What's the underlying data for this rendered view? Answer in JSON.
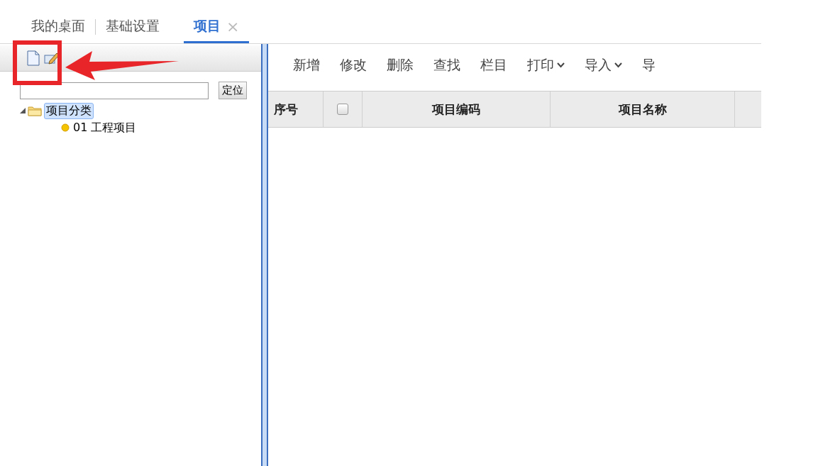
{
  "tabs": [
    {
      "label": "我的桌面",
      "selected": false,
      "closable": false
    },
    {
      "label": "基础设置",
      "selected": false,
      "closable": false
    },
    {
      "label": "项目",
      "selected": true,
      "closable": true,
      "close_glyph": "×"
    }
  ],
  "tree_panel": {
    "locate_button": "定位",
    "tree": [
      {
        "label": "项目分类",
        "selected": true,
        "expanded": true,
        "children": [
          {
            "label": "01 工程项目",
            "selected": false
          }
        ]
      }
    ]
  },
  "toolbar": [
    {
      "label": "新增",
      "dropdown": false
    },
    {
      "label": "修改",
      "dropdown": false
    },
    {
      "label": "删除",
      "dropdown": false
    },
    {
      "label": "查找",
      "dropdown": false
    },
    {
      "label": "栏目",
      "dropdown": false
    },
    {
      "label": "打印",
      "dropdown": true
    },
    {
      "label": "导入",
      "dropdown": true
    },
    {
      "label": "导",
      "dropdown": false
    }
  ],
  "table": {
    "columns": [
      {
        "kind": "text",
        "label": "序号"
      },
      {
        "kind": "checkbox",
        "checked": false
      },
      {
        "kind": "text",
        "label": "项目编码"
      },
      {
        "kind": "text",
        "label": "项目名称"
      },
      {
        "kind": "blank"
      }
    ]
  }
}
